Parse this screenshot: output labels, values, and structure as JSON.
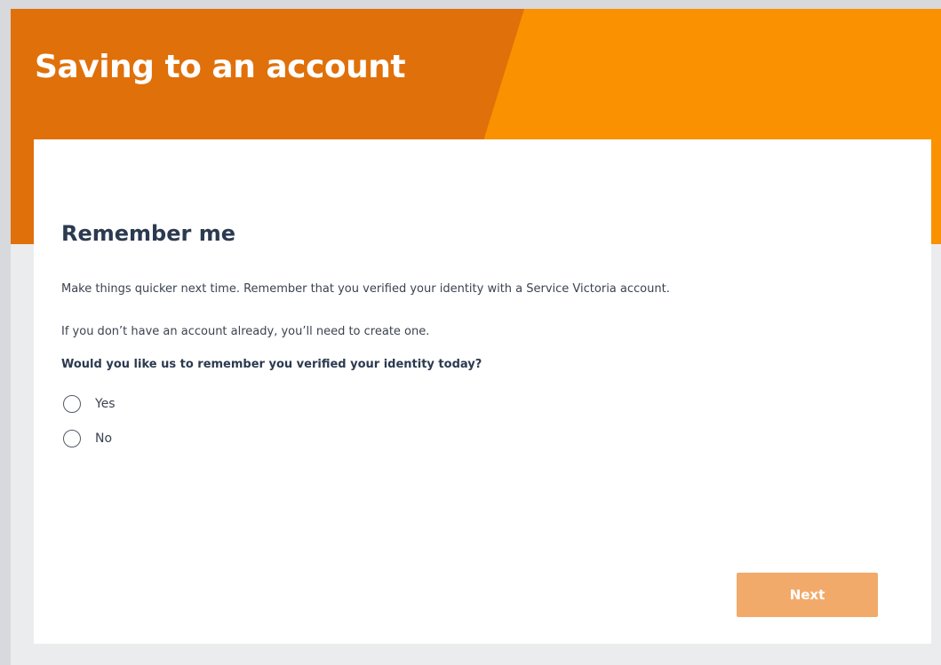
{
  "header": {
    "title": "Saving to an account"
  },
  "section": {
    "heading": "Remember me",
    "paragraphs": [
      "Make things quicker next time. Remember that you verified your identity with a Service Victoria account.",
      "If you don’t have an account already, you’ll need to create one."
    ],
    "question": "Would you like us to remember you verified your identity today?",
    "options": [
      "Yes",
      "No"
    ]
  },
  "actions": {
    "next_label": "Next"
  },
  "colors": {
    "header_orange": "#fa9100",
    "header_dark_orange": "#e0700a",
    "next_button": "#f2aa6a",
    "heading_navy": "#2b3a4f"
  }
}
